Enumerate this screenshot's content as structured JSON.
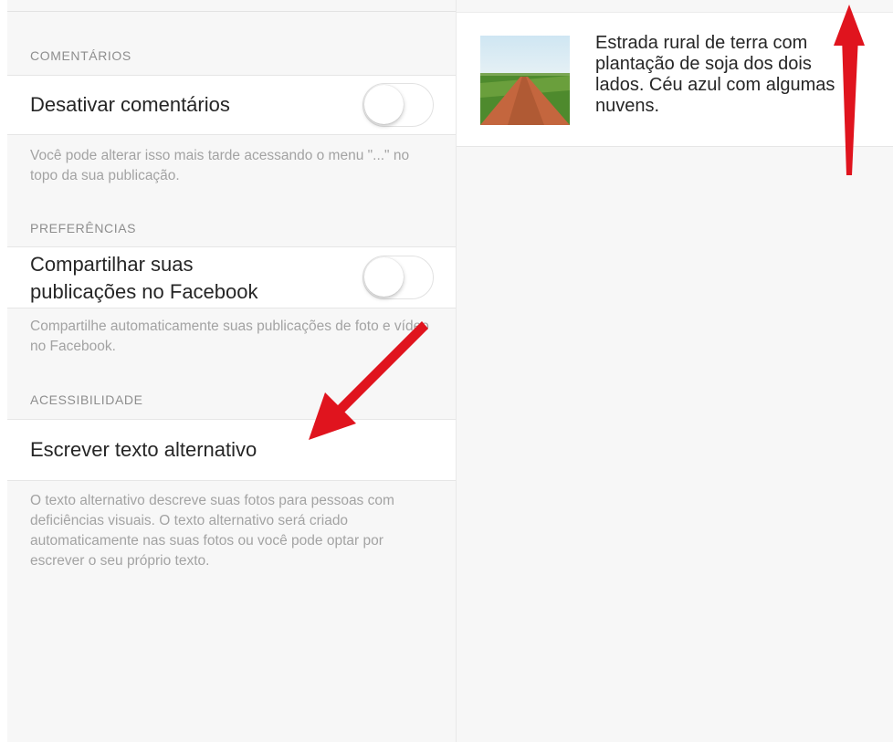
{
  "settings": {
    "comments": {
      "header": "COMENTÁRIOS",
      "toggle_label": "Desativar comentários",
      "toggle_on": false,
      "footnote": "Você pode alterar isso mais tarde acessando o menu \"...\" no topo da sua publicação."
    },
    "preferences": {
      "header": "PREFERÊNCIAS",
      "toggle_label_line1": "Compartilhar suas",
      "toggle_label_line2": "publicações no Facebook",
      "toggle_on": false,
      "footnote": "Compartilhe automaticamente suas publicações de foto e vídeo no Facebook."
    },
    "accessibility": {
      "header": "ACESSIBILIDADE",
      "row_label": "Escrever texto alternativo",
      "footnote": "O texto alternativo descreve suas fotos para pessoas com deficiências visuais. O texto alternativo será criado automaticamente nas suas fotos ou você pode optar por escrever o seu próprio texto."
    }
  },
  "preview": {
    "alt_text": "Estrada rural de terra com plantação de soja dos dois lados. Céu azul com algumas nuvens."
  },
  "colors": {
    "annotation_arrow": "#e0141e",
    "section_text": "#8e8e8e",
    "label_text": "#262626",
    "footnote_text": "#a3a3a3",
    "background": "#f7f7f7"
  },
  "icons": {
    "annotation_arrows": [
      "arrow-up-annotation-icon",
      "arrow-down-left-annotation-icon"
    ]
  }
}
